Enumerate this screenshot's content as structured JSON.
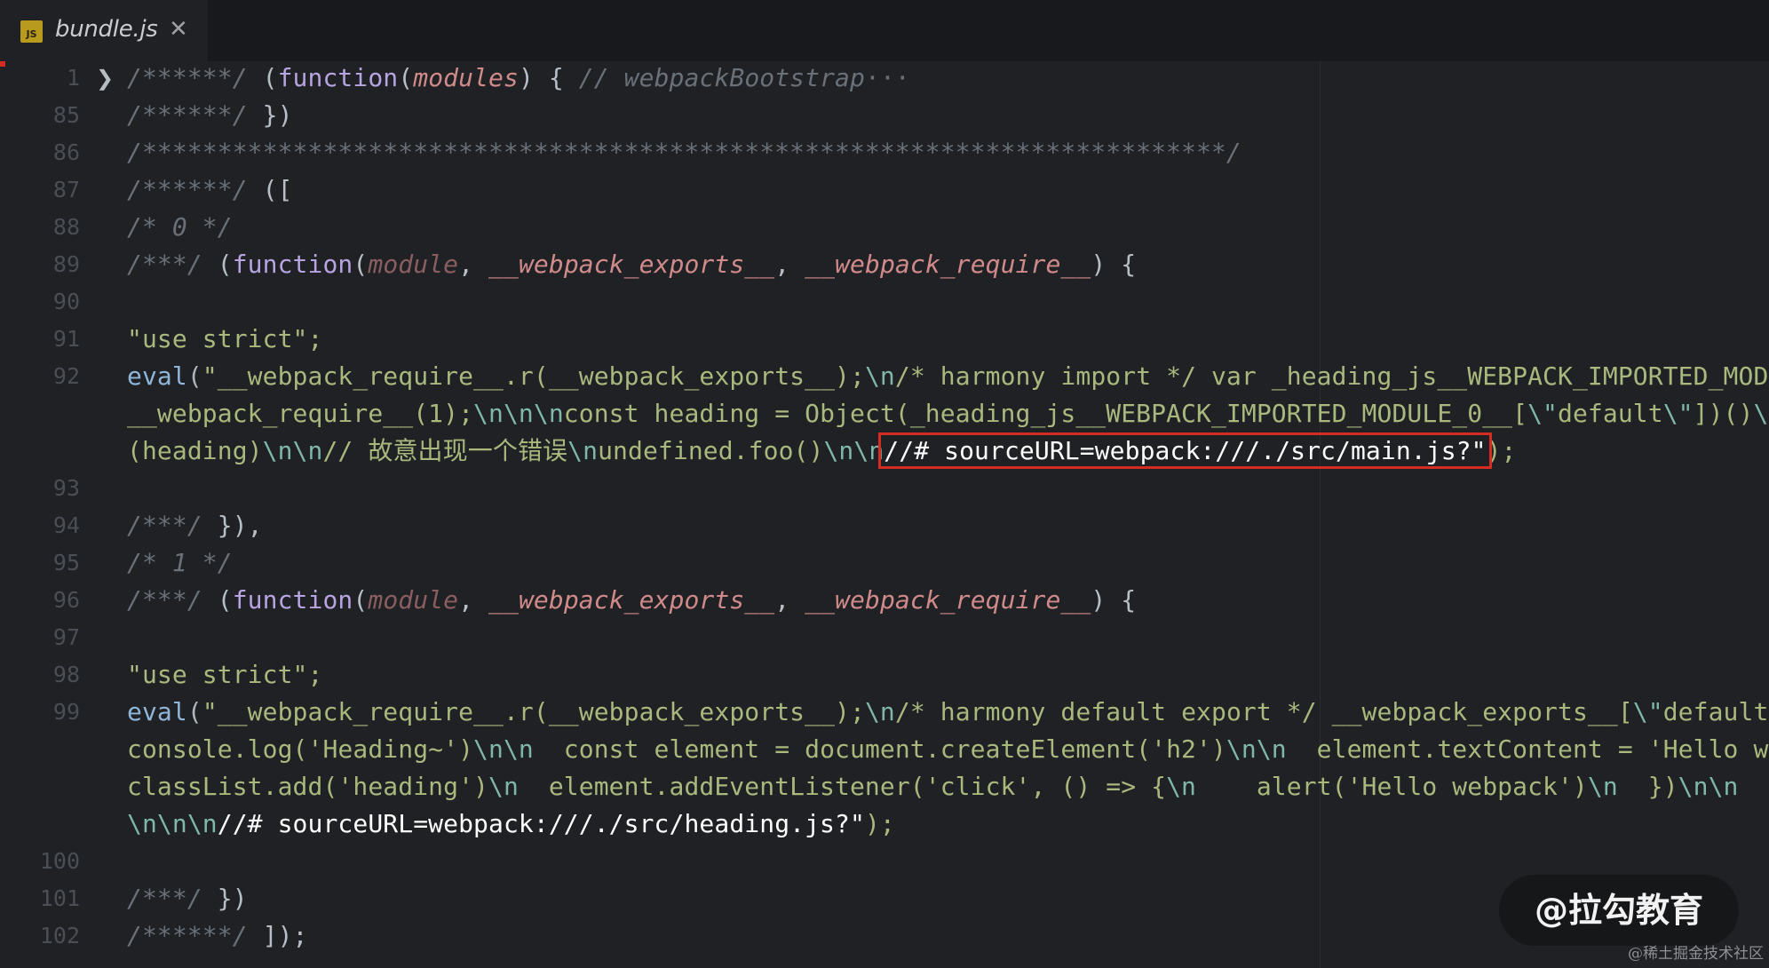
{
  "tab": {
    "icon_label": "JS",
    "title": "bundle.js",
    "close": "✕"
  },
  "editor": {
    "fold_marker": "❯",
    "lines": [
      {
        "n": "1",
        "fold": true,
        "text": "/******/ (function(modules) { // webpackBootstrap···"
      },
      {
        "n": "85",
        "text": "/******/ })"
      },
      {
        "n": "86",
        "text": "/************************************************************************/"
      },
      {
        "n": "87",
        "text": "/******/ (["
      },
      {
        "n": "88",
        "text": "/* 0 */"
      },
      {
        "n": "89",
        "text": "/***/ (function(module, __webpack_exports__, __webpack_require__) {"
      },
      {
        "n": "90",
        "text": ""
      },
      {
        "n": "91",
        "text": "\"use strict\";"
      },
      {
        "n": "92",
        "text": "eval(\"__webpack_require__.r(__webpack_exports__);\\n/* harmony import */ var _heading_js__WEBPACK_IMPORTED_MODU"
      },
      {
        "n": "",
        "text": "__webpack_require__(1);\\n\\n\\nconst heading = Object(_heading_js__WEBPACK_IMPORTED_MODULE_0__[\\\"default\\\"])()\\n"
      },
      {
        "n": "",
        "text": "(heading)\\n\\n// 故意出现一个错误\\nundefined.foo()\\n\\n//# sourceURL=webpack:///./src/main.js?\");"
      },
      {
        "n": "93",
        "text": ""
      },
      {
        "n": "94",
        "text": "/***/ }),"
      },
      {
        "n": "95",
        "text": "/* 1 */"
      },
      {
        "n": "96",
        "text": "/***/ (function(module, __webpack_exports__, __webpack_require__) {"
      },
      {
        "n": "97",
        "text": ""
      },
      {
        "n": "98",
        "text": "\"use strict\";"
      },
      {
        "n": "99",
        "text": "eval(\"__webpack_require__.r(__webpack_exports__);\\n/* harmony default export */ __webpack_exports__[\\\"default\\"
      },
      {
        "n": "",
        "text": "console.log('Heading~')\\n\\n  const element = document.createElement('h2')\\n\\n  element.textContent = 'Hello wo"
      },
      {
        "n": "",
        "text": "classList.add('heading')\\n  element.addEventListener('click', () => {\\n    alert('Hello webpack')\\n  })\\n\\n  r"
      },
      {
        "n": "",
        "text": "\\n\\n\\n//# sourceURL=webpack:///./src/heading.js?\");"
      },
      {
        "n": "100",
        "text": ""
      },
      {
        "n": "101",
        "text": "/***/ })"
      },
      {
        "n": "102",
        "text": "/******/ ]);"
      }
    ]
  },
  "highlights": {
    "main": "//# sourceURL=webpack:///./src/main.js?\"",
    "heading": "//# sourceURL=webpack:///./src/heading.js?\""
  },
  "watermark": {
    "brand": "@拉勾教育",
    "credit": "@稀土掘金技术社区"
  },
  "colors": {
    "background": "#1f2125",
    "highlight_border": "#d42b22",
    "keyword": "#b7a4e0",
    "string": "#a9b87d",
    "comment": "#6a7078"
  }
}
